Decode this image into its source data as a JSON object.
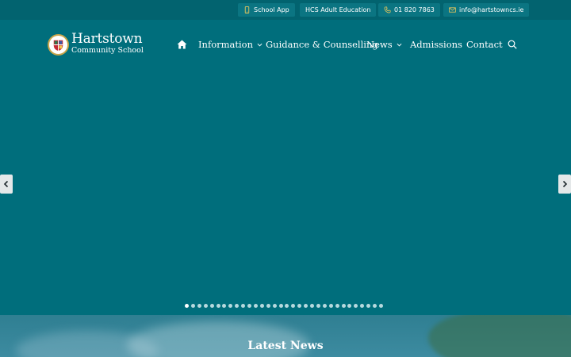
{
  "topbar": {
    "school_app": "School App",
    "adult_education": "HCS Adult Education",
    "phone": "01 820 7863",
    "email": "info@hartstowncs.ie"
  },
  "brand": {
    "name_line1": "Hartstown",
    "name_line2": "Community School"
  },
  "nav": {
    "home_icon": "home-icon",
    "items": [
      {
        "label": "Information",
        "has_dropdown": true
      },
      {
        "label": "Guidance & Counselling",
        "has_dropdown": false
      },
      {
        "label": "News",
        "has_dropdown": true
      },
      {
        "label": "Admissions",
        "has_dropdown": false
      },
      {
        "label": "Contact",
        "has_dropdown": false
      }
    ],
    "search_icon": "search-icon"
  },
  "slider": {
    "slide_count": 32,
    "active_slide": 1,
    "prev_icon": "chevron-left-icon",
    "next_icon": "chevron-right-icon"
  },
  "latest_news": {
    "title": "Latest News"
  },
  "colors": {
    "brand_teal": "#006e7c",
    "topbar": "#02636f",
    "pill": "#0b7582",
    "accent_gold": "#c8a44a"
  }
}
